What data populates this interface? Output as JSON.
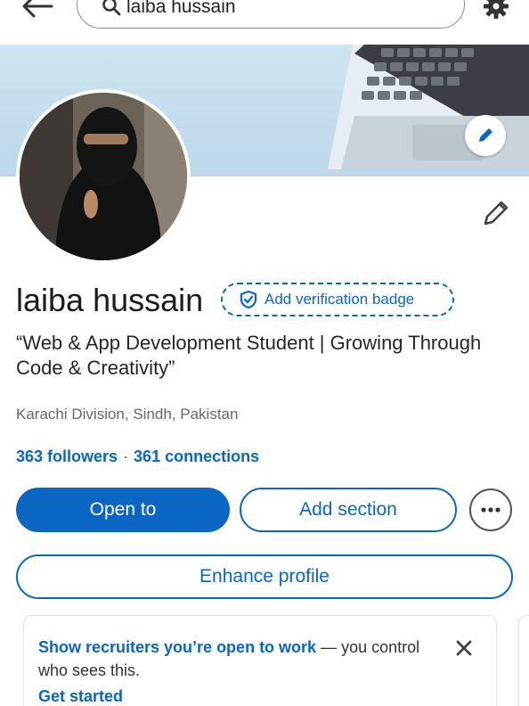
{
  "search": {
    "query": "laiba hussain"
  },
  "profile": {
    "name": "laiba hussain",
    "verification_label": "Add verification badge",
    "headline": "“Web & App Development Student | Growing Through Code & Creativity”",
    "location": "Karachi Division, Sindh, Pakistan",
    "followers": "363 followers",
    "separator": "·",
    "connections": "361 connections"
  },
  "actions": {
    "open_to": "Open to",
    "add_section": "Add section",
    "enhance_profile": "Enhance profile"
  },
  "open_to_work_card": {
    "highlight": "Show recruiters you’re open to work",
    "rest": " — you control who sees this.",
    "link": "Get started"
  },
  "colors": {
    "accent": "#0a66c2",
    "cover": "#c6dfee"
  },
  "icons": [
    "back-arrow-icon",
    "search-icon",
    "gear-icon",
    "pencil-icon",
    "shield-check-icon",
    "more-icon",
    "close-icon"
  ]
}
